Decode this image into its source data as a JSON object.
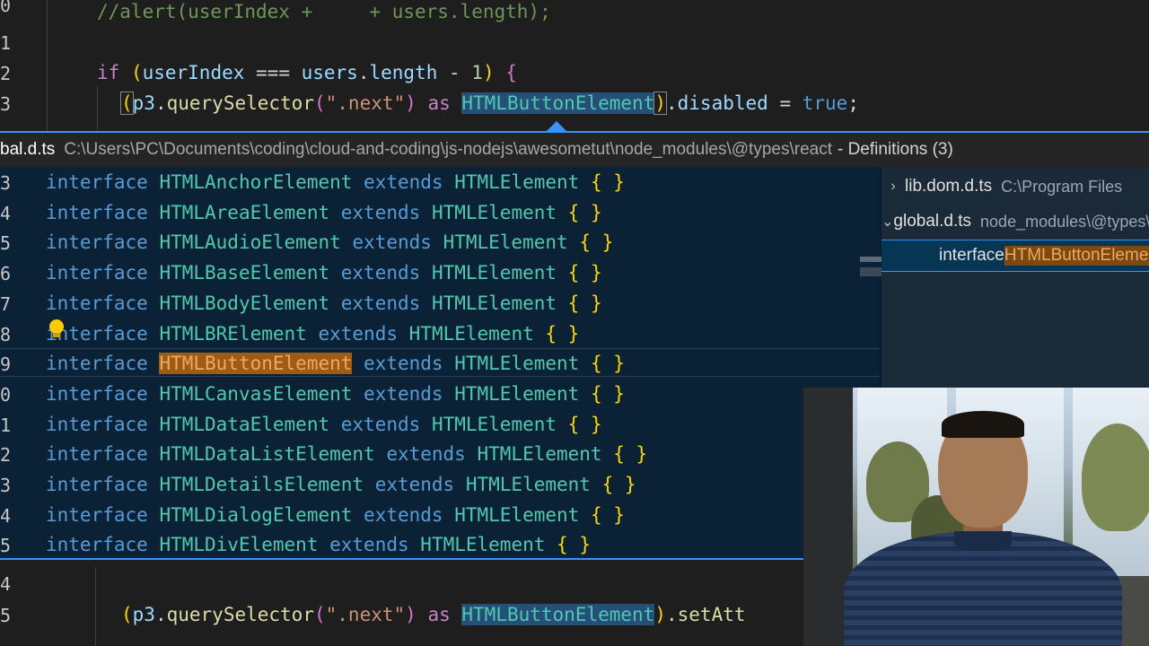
{
  "editor_top": {
    "line_numbers": [
      "0",
      "1",
      "2",
      "3"
    ],
    "line0_comment": "//alert(userIndex +     + users.length);",
    "line2": {
      "if_kw": "if",
      "open_paren": " (",
      "userIndex": "userIndex",
      "op": " === ",
      "users": "users",
      "dot": ".",
      "length": "length",
      "minus": " - ",
      "one": "1",
      "close_paren": ")",
      "brace": " {"
    },
    "line3": {
      "open_paren": "(",
      "p3": "p3",
      "dot": ".",
      "querySelector": "querySelector",
      "open2": "(",
      "selector": "\".next\"",
      "close2": ")",
      "as_kw": " as ",
      "type": "HTMLButtonElement",
      "close_paren": ")",
      "dot2": ".",
      "disabled": "disabled",
      "eq": " = ",
      "true_kw": "true",
      "semi": ";"
    }
  },
  "peek": {
    "header_file": "bal.d.ts",
    "header_path": "C:\\Users\\PC\\Documents\\coding\\cloud-and-coding\\js-nodejs\\awesometut\\node_modules\\@types\\react",
    "header_defs": "- Definitions (3)",
    "gutter": [
      "3",
      "4",
      "5",
      "6",
      "7",
      "8",
      "9",
      "0",
      "1",
      "2",
      "3",
      "4",
      "5"
    ],
    "lines": [
      {
        "name": "HTMLAnchorElement"
      },
      {
        "name": "HTMLAreaElement"
      },
      {
        "name": "HTMLAudioElement"
      },
      {
        "name": "HTMLBaseElement"
      },
      {
        "name": "HTMLBodyElement"
      },
      {
        "name": "HTMLBRElement"
      },
      {
        "name": "HTMLButtonElement"
      },
      {
        "name": "HTMLCanvasElement"
      },
      {
        "name": "HTMLDataElement"
      },
      {
        "name": "HTMLDataListElement"
      },
      {
        "name": "HTMLDetailsElement"
      },
      {
        "name": "HTMLDialogElement"
      },
      {
        "name": "HTMLDivElement"
      }
    ],
    "keyword_interface": "interface",
    "keyword_extends": "extends",
    "base_type": "HTMLElement",
    "braces": "{ }",
    "tree": {
      "item1_name": "lib.dom.d.ts",
      "item1_desc": "C:\\Program Files",
      "item2_name": "global.d.ts",
      "item2_desc": "node_modules\\@types\\react",
      "item3_kw": "interface",
      "item3_type": "HTMLButtonElement"
    }
  },
  "editor_bottom": {
    "line_numbers": [
      "4",
      "5"
    ],
    "line5": {
      "open_paren": "(",
      "p3": "p3",
      "dot": ".",
      "querySelector": "querySelector",
      "open2": "(",
      "selector": "\".next\"",
      "close2": ")",
      "as_kw": " as ",
      "type": "HTMLButtonElement",
      "close_paren": ")",
      "dot2": ".",
      "setAtt": "setAtt"
    }
  },
  "colors": {
    "accent": "#3794ff",
    "keyword": "#569cd6",
    "type": "#4ec9b0",
    "string": "#ce9178",
    "match_highlight": "#9e5b13"
  }
}
